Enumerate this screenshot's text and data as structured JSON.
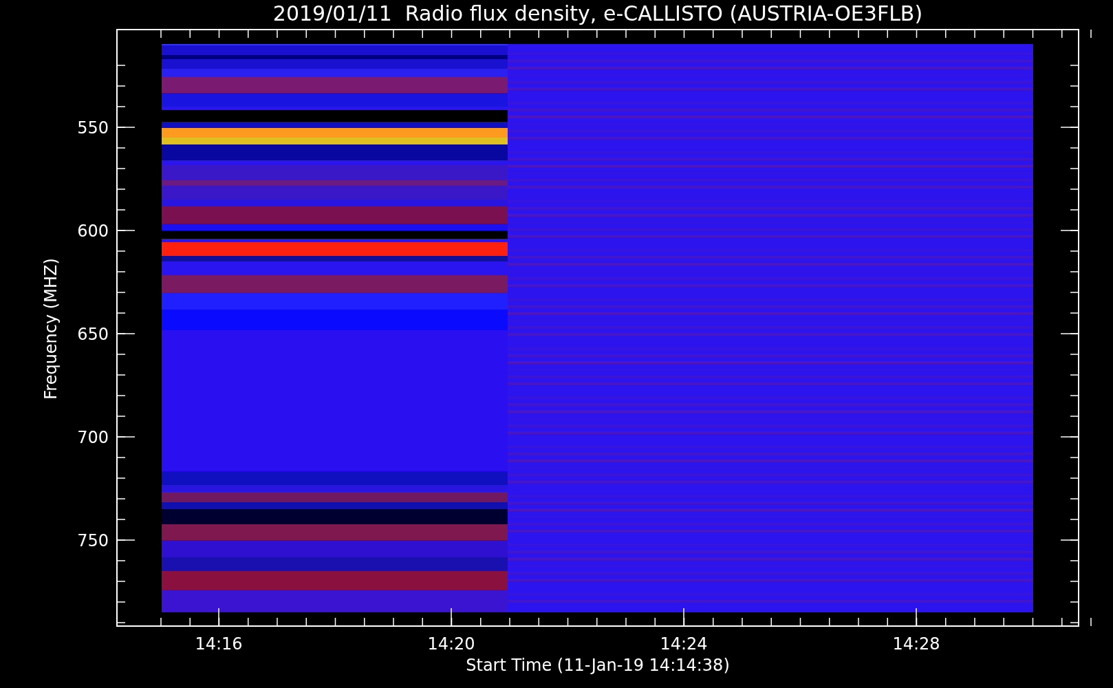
{
  "plot": {
    "title": "2019/01/11  Radio flux density, e-CALLISTO (AUSTRIA-OE3FLB)",
    "x_axis": {
      "label": "Start Time (11-Jan-19 14:14:38)",
      "ticks": [
        "14:16",
        "14:20",
        "14:24",
        "14:28"
      ]
    },
    "y_axis": {
      "label": "Frequency (MHZ)",
      "ticks": [
        "550",
        "600",
        "650",
        "700",
        "750"
      ]
    }
  }
}
